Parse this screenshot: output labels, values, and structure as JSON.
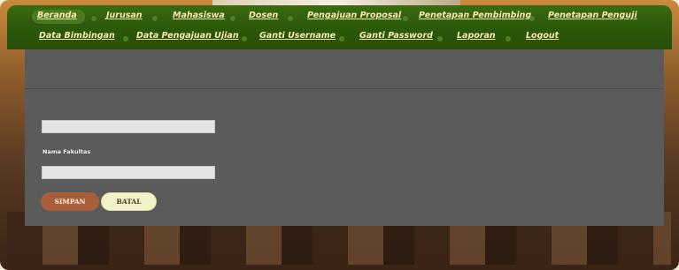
{
  "nav": {
    "row1": [
      "Beranda",
      "Jurusan",
      "Mahasiswa",
      "Dosen",
      "Pengajuan Proposal",
      "Penetapan Pembimbing",
      "Penetapan Penguji"
    ],
    "row2": [
      "Data Bimbingan",
      "Data Pengajuan Ujian",
      "Ganti Username",
      "Ganti Password",
      "Laporan",
      "Logout"
    ]
  },
  "form": {
    "field1_value": "",
    "field2_label": "Nama Fakultas",
    "field2_value": "",
    "save_label": "SIMPAN",
    "cancel_label": "BATAL"
  },
  "colors": {
    "nav_bg": "#2d5a0b",
    "nav_link": "#f6e8b0",
    "panel_bg": "#5b5b5b",
    "save_btn": "#a95f3a",
    "cancel_btn": "#f3f2c8"
  }
}
